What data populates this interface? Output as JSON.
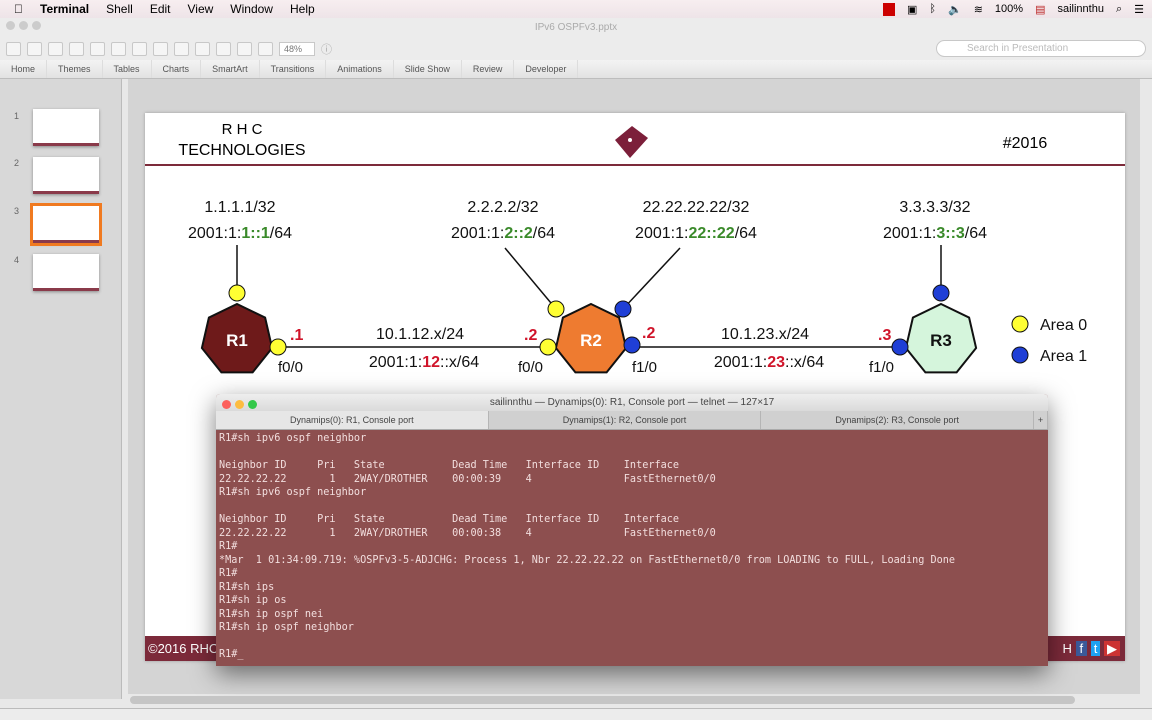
{
  "menubar": {
    "app": "Terminal",
    "items": [
      "Shell",
      "Edit",
      "View",
      "Window",
      "Help"
    ],
    "battery": "100%",
    "user": "sailinnthu"
  },
  "ppt": {
    "title": "IPv6 OSPFv3.pptx",
    "zoom": "48%",
    "search_placeholder": "Search in Presentation",
    "ribbon": [
      "Home",
      "Themes",
      "Tables",
      "Charts",
      "SmartArt",
      "Transitions",
      "Animations",
      "Slide Show",
      "Review",
      "Developer"
    ],
    "slides": [
      {
        "num": "1"
      },
      {
        "num": "2"
      },
      {
        "num": "3",
        "selected": true
      },
      {
        "num": "4"
      }
    ]
  },
  "slide": {
    "brand_line1": "R H C",
    "brand_line2": "TECHNOLOGIES",
    "tag": "#2016",
    "footer": "©2016 RHC",
    "footer_right": "H",
    "routers": [
      {
        "name": "R1",
        "color": "#6e1a1a"
      },
      {
        "name": "R2",
        "color": "#ee7b30"
      },
      {
        "name": "R3",
        "color": "#d5f5dc"
      }
    ],
    "loopbacks": [
      {
        "v4": "1.1.1.1/32",
        "v6": [
          "2001:1:",
          "1::1",
          "/64"
        ]
      },
      {
        "v4": "2.2.2.2/32",
        "v6": [
          "2001:1:",
          "2::2",
          "/64"
        ]
      },
      {
        "v4": "22.22.22.22/32",
        "v6": [
          "2001:1:",
          "22::22",
          "/64"
        ]
      },
      {
        "v4": "3.3.3.3/32",
        "v6": [
          "2001:1:",
          "3::3",
          "/64"
        ]
      }
    ],
    "links": [
      {
        "v4": "10.1.12.x/24",
        "v6": [
          "2001:1:",
          "12",
          "::x/64"
        ]
      },
      {
        "v4": "10.1.23.x/24",
        "v6": [
          "2001:1:",
          "23",
          "::x/64"
        ]
      }
    ],
    "host_ids": [
      ".1",
      ".2",
      ".2",
      ".3"
    ],
    "interfaces": [
      "f0/0",
      "f0/0",
      "f1/0",
      "f1/0"
    ],
    "legend": [
      {
        "label": "Area 0",
        "color": "#ffff33"
      },
      {
        "label": "Area 1",
        "color": "#1f3fd6"
      }
    ],
    "highlight_green": "#3a8a2a",
    "highlight_red": "#d0142a"
  },
  "terminal": {
    "title": "sailinnthu — Dynamips(0): R1, Console port — telnet — 127×17",
    "tabs": [
      "Dynamips(0): R1, Console port",
      "Dynamips(1): R2, Console port",
      "Dynamips(2): R3, Console port"
    ],
    "lines": [
      "R1#sh ipv6 ospf neighbor",
      "",
      "Neighbor ID     Pri   State           Dead Time   Interface ID    Interface",
      "22.22.22.22       1   2WAY/DROTHER    00:00:39    4               FastEthernet0/0",
      "R1#sh ipv6 ospf neighbor",
      "",
      "Neighbor ID     Pri   State           Dead Time   Interface ID    Interface",
      "22.22.22.22       1   2WAY/DROTHER    00:00:38    4               FastEthernet0/0",
      "R1#",
      "*Mar  1 01:34:09.719: %OSPFv3-5-ADJCHG: Process 1, Nbr 22.22.22.22 on FastEthernet0/0 from LOADING to FULL, Loading Done",
      "R1#",
      "R1#sh ips",
      "R1#sh ip os",
      "R1#sh ip ospf nei",
      "R1#sh ip ospf neighbor",
      "",
      "R1#_"
    ]
  }
}
